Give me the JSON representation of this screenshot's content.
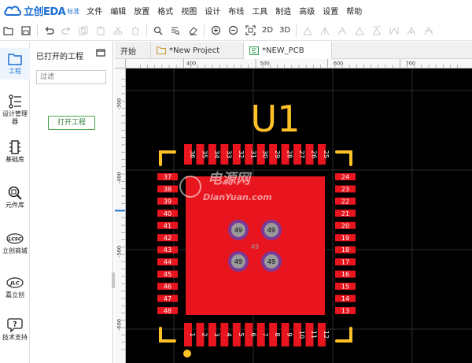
{
  "app": {
    "brand": "立创EDA",
    "edition": "标准"
  },
  "menu": [
    "文件",
    "编辑",
    "放置",
    "格式",
    "视图",
    "设计",
    "布线",
    "工具",
    "制造",
    "高级",
    "设置",
    "帮助"
  ],
  "toolbar": {
    "view_2d": "2D",
    "view_3d": "3D"
  },
  "rail": [
    {
      "label": "工程",
      "icon": "folder-icon"
    },
    {
      "label": "设计管理器",
      "icon": "tree-list-icon"
    },
    {
      "label": "基础库",
      "icon": "chip-icon"
    },
    {
      "label": "元件库",
      "icon": "magnifier-icon"
    },
    {
      "label": "立创商城",
      "icon": "lcsc-icon"
    },
    {
      "label": "嘉立创",
      "icon": "jlc-icon"
    },
    {
      "label": "技术支持",
      "icon": "help-icon"
    }
  ],
  "rail_icon_text": {
    "lcsc": "LCSC",
    "jlc": "JLC"
  },
  "panel": {
    "title": "已打开的工程",
    "filter_placeholder": "过滤",
    "open_project": "打开工程"
  },
  "tabs": [
    {
      "label": "开始"
    },
    {
      "label": "*New Project"
    },
    {
      "label": "*NEW_PCB"
    }
  ],
  "ruler": {
    "h_labels": [
      "400",
      "500",
      "600",
      "700"
    ],
    "v_labels": [
      "-300",
      "-400",
      "-500",
      "-600"
    ]
  },
  "pcb": {
    "designator": "U1",
    "center_pad": "49",
    "vias": [
      "49",
      "49",
      "49",
      "49"
    ],
    "pads_left": [
      "37",
      "38",
      "39",
      "40",
      "41",
      "42",
      "43",
      "44",
      "45",
      "46",
      "47",
      "48"
    ],
    "pads_bottom": [
      "1",
      "2",
      "3",
      "4",
      "5",
      "6",
      "7",
      "8",
      "9",
      "10",
      "11",
      "12"
    ],
    "pads_right": [
      "24",
      "23",
      "22",
      "21",
      "20",
      "19",
      "18",
      "17",
      "16",
      "15",
      "14",
      "13"
    ],
    "pads_top": [
      "36",
      "35",
      "34",
      "33",
      "32",
      "31",
      "30",
      "29",
      "28",
      "27",
      "26",
      "25"
    ],
    "watermark_cn": "电源网",
    "watermark_en": "DianYuan.com",
    "colors": {
      "board": "#000000",
      "pad": "#e8151e",
      "silkscreen": "#ffc125",
      "via_ring": "#7a3a96",
      "via_hole": "#9a9a9a"
    }
  }
}
